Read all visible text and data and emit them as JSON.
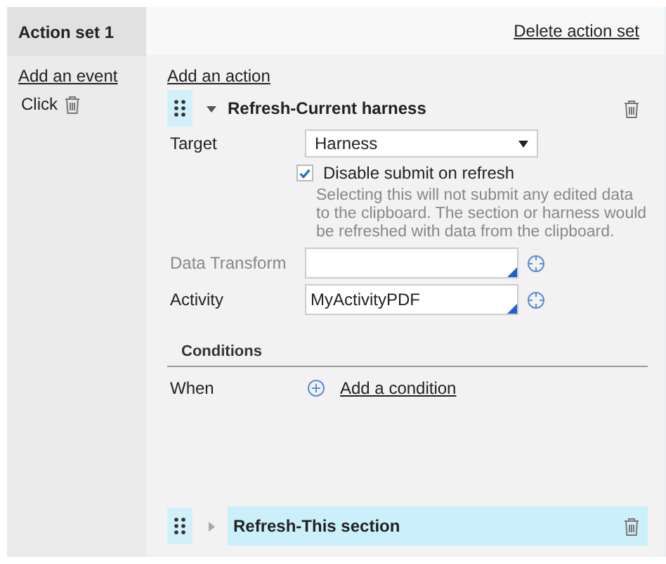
{
  "action_set": {
    "title": "Action set 1",
    "delete_link": "Delete action set"
  },
  "events": {
    "add_link": "Add an event",
    "items": [
      {
        "label": "Click"
      }
    ]
  },
  "add_action_link": "Add an action",
  "actions": [
    {
      "title": "Refresh-Current harness",
      "expanded": true,
      "target": {
        "label": "Target",
        "value": "Harness"
      },
      "checkbox": {
        "label": "Disable submit on refresh",
        "checked": true
      },
      "help": "Selecting this will not submit any edited data to the clipboard. The section or harness would be refreshed with data from the clipboard.",
      "fields": [
        {
          "label": "Data Transform",
          "dimmed": true
        },
        {
          "label": "Activity",
          "value": "MyActivityPDF",
          "dimmed": false
        }
      ],
      "conditions": {
        "heading": "Conditions",
        "when_label": "When",
        "add_link": "Add a condition"
      }
    },
    {
      "title": "Refresh-This section",
      "expanded": false
    }
  ]
}
